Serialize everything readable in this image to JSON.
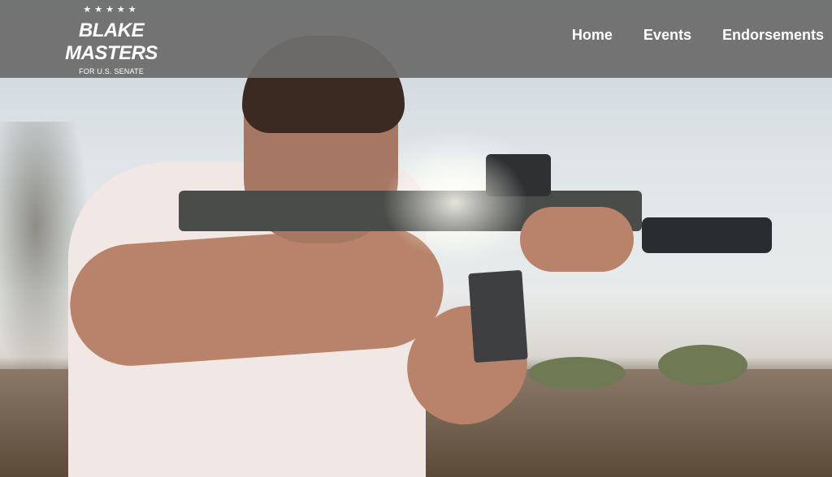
{
  "header": {
    "logo": {
      "stars": "★★★★★",
      "name": "BLAKE MASTERS",
      "subtitle": "FOR U.S. SENATE"
    },
    "nav": [
      {
        "label": "Home"
      },
      {
        "label": "Events"
      },
      {
        "label": "Endorsements"
      }
    ]
  },
  "hero": {
    "image": "man-aiming-rifle-photo"
  },
  "colors": {
    "header_bg": "#6e6e6e",
    "header_text": "#ffffff"
  }
}
